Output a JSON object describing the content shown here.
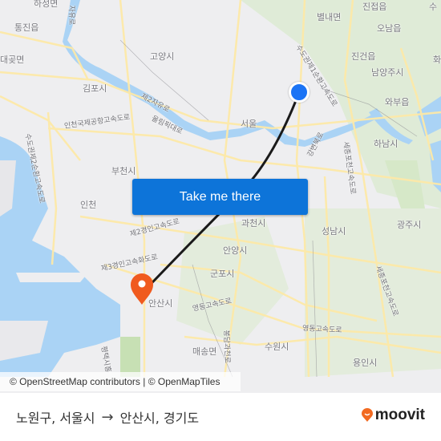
{
  "map": {
    "places": [
      {
        "name": "하성면",
        "id": "place-haseong"
      },
      {
        "name": "통진읍",
        "id": "place-tongjin"
      },
      {
        "name": "대곶면",
        "id": "place-daegot"
      },
      {
        "name": "김포시",
        "id": "place-gimpo"
      },
      {
        "name": "고양시",
        "id": "place-goyang"
      },
      {
        "name": "별내면",
        "id": "place-byeollae"
      },
      {
        "name": "진접읍",
        "id": "place-jinjeop"
      },
      {
        "name": "오남읍",
        "id": "place-onam"
      },
      {
        "name": "진건읍",
        "id": "place-jingeon"
      },
      {
        "name": "남양주시",
        "id": "place-namyangju"
      },
      {
        "name": "와부읍",
        "id": "place-wabu"
      },
      {
        "name": "서울",
        "id": "place-seoul"
      },
      {
        "name": "하남시",
        "id": "place-hanam"
      },
      {
        "name": "부천시",
        "id": "place-bucheon"
      },
      {
        "name": "인천",
        "id": "place-incheon"
      },
      {
        "name": "과천시",
        "id": "place-gwacheon"
      },
      {
        "name": "성남시",
        "id": "place-seongnam"
      },
      {
        "name": "광주시",
        "id": "place-gwangju"
      },
      {
        "name": "안양시",
        "id": "place-anyang"
      },
      {
        "name": "군포시",
        "id": "place-gunpo"
      },
      {
        "name": "안산시",
        "id": "place-ansan"
      },
      {
        "name": "매송면",
        "id": "place-maesong"
      },
      {
        "name": "수원시",
        "id": "place-suwon"
      },
      {
        "name": "용인시",
        "id": "place-yongin"
      },
      {
        "name": "화",
        "id": "place-hwa"
      },
      {
        "name": "수",
        "id": "place-su"
      }
    ],
    "roads": [
      {
        "name": "제2자유로"
      },
      {
        "name": "올림픽대로"
      },
      {
        "name": "인천국제공항고속도로"
      },
      {
        "name": "수도권제2순환고속도로"
      },
      {
        "name": "수도권제1순환고속도로"
      },
      {
        "name": "제2경인고속도로"
      },
      {
        "name": "제3경인고속화도로"
      },
      {
        "name": "영동고속도로"
      },
      {
        "name": "세종포천고속도로"
      },
      {
        "name": "평택시흥"
      },
      {
        "name": "봉담과천로"
      },
      {
        "name": "강변북로"
      },
      {
        "name": "자유로"
      }
    ],
    "cta_label": "Take me there",
    "attribution": "© OpenStreetMap contributors | © OpenMapTiles",
    "colors": {
      "origin": "#1a73f5",
      "destination": "#f05a1e",
      "route": "#1a1a1a",
      "cta": "#0d74d9",
      "water": "#aad3f5",
      "park": "#d6e8c8"
    }
  },
  "footer": {
    "origin": "노원구, 서울시",
    "arrow": "→",
    "destination": "안산시, 경기도",
    "brand": "moovit",
    "brand_color": "#f26a21"
  }
}
